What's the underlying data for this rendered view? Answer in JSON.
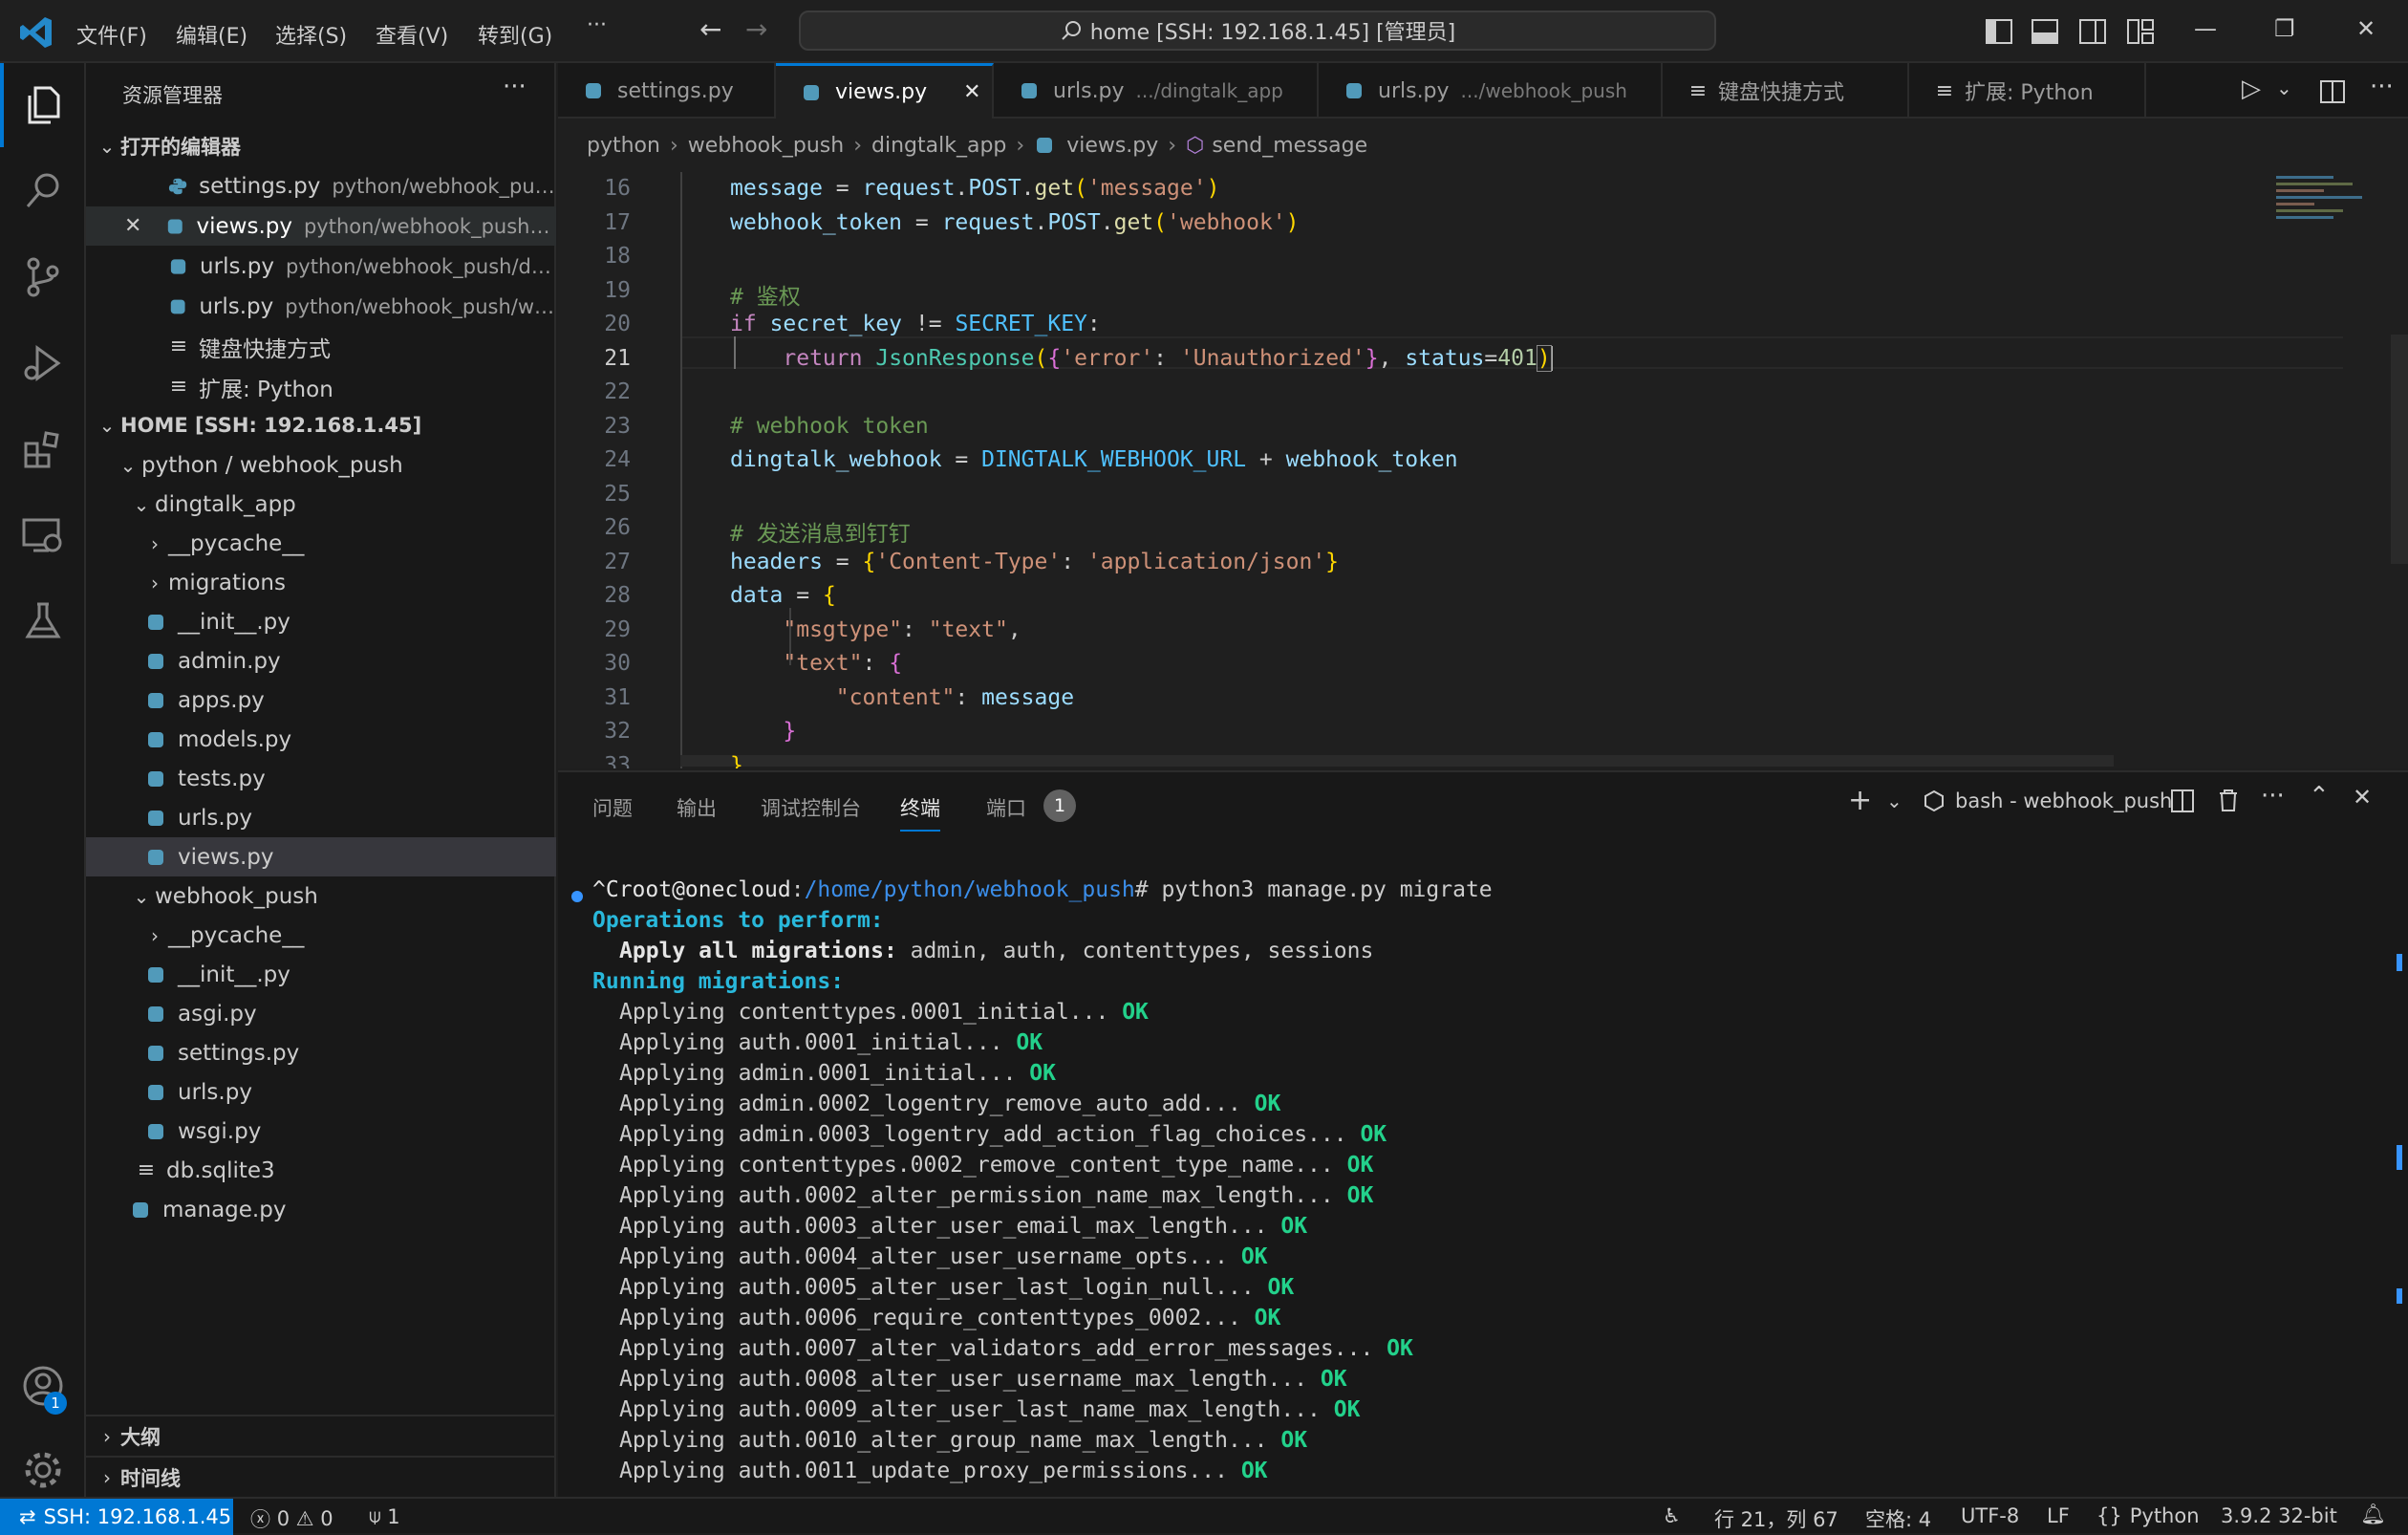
{
  "titlebar": {
    "menus": [
      "文件(F)",
      "编辑(E)",
      "选择(S)",
      "查看(V)",
      "转到(G)",
      "···"
    ],
    "search_text": "home [SSH: 192.168.1.45] [管理员]"
  },
  "sidebar": {
    "title": "资源管理器",
    "open_editors_header": "打开的编辑器",
    "open_editors": [
      {
        "name": "settings.py",
        "desc": "python/webhook_push..."
      },
      {
        "name": "views.py",
        "desc": "python/webhook_push/di..."
      },
      {
        "name": "urls.py",
        "desc": "python/webhook_push/din..."
      },
      {
        "name": "urls.py",
        "desc": "python/webhook_push/web..."
      },
      {
        "name": "键盘快捷方式",
        "desc": ""
      },
      {
        "name": "扩展: Python",
        "desc": ""
      }
    ],
    "workspace_header": "HOME [SSH: 192.168.1.45]",
    "tree": [
      {
        "label": "python / webhook_push"
      },
      {
        "label": "dingtalk_app"
      },
      {
        "label": "__pycache__"
      },
      {
        "label": "migrations"
      },
      {
        "label": "__init__.py"
      },
      {
        "label": "admin.py"
      },
      {
        "label": "apps.py"
      },
      {
        "label": "models.py"
      },
      {
        "label": "tests.py"
      },
      {
        "label": "urls.py"
      },
      {
        "label": "views.py"
      },
      {
        "label": "webhook_push"
      },
      {
        "label": "__pycache__"
      },
      {
        "label": "__init__.py"
      },
      {
        "label": "asgi.py"
      },
      {
        "label": "settings.py"
      },
      {
        "label": "urls.py"
      },
      {
        "label": "wsgi.py"
      },
      {
        "label": "db.sqlite3"
      },
      {
        "label": "manage.py"
      }
    ],
    "outline_header": "大纲",
    "timeline_header": "时间线",
    "accounts_badge": "1"
  },
  "tabs": [
    {
      "name": "settings.py",
      "desc": ""
    },
    {
      "name": "views.py",
      "desc": ""
    },
    {
      "name": "urls.py",
      "desc": ".../dingtalk_app"
    },
    {
      "name": "urls.py",
      "desc": ".../webhook_push"
    },
    {
      "name": "键盘快捷方式",
      "desc": ""
    },
    {
      "name": "扩展: Python",
      "desc": ""
    }
  ],
  "breadcrumb": [
    "python",
    "webhook_push",
    "dingtalk_app",
    "views.py",
    "send_message"
  ],
  "editor": {
    "line_numbers": [
      "16",
      "17",
      "18",
      "19",
      "20",
      "21",
      "22",
      "23",
      "24",
      "25",
      "26",
      "27",
      "28",
      "29",
      "30",
      "31",
      "32",
      "33"
    ],
    "current_line": "21"
  },
  "panel": {
    "tabs": [
      "问题",
      "输出",
      "调试控制台",
      "终端",
      "端口"
    ],
    "ports_badge": "1",
    "terminal_name": "bash - webhook_push",
    "prompt_user": "^Croot@onecloud",
    "prompt_path": "/home/python/webhook_push",
    "command": "# python3 manage.py migrate",
    "ops_header": "Operations to perform:",
    "apply_all_label": "Apply all migrations:",
    "apply_all_value": " admin, auth, contenttypes, sessions",
    "running_header": "Running migrations:",
    "migrations": [
      "contenttypes.0001_initial...",
      "auth.0001_initial...",
      "admin.0001_initial...",
      "admin.0002_logentry_remove_auto_add...",
      "admin.0003_logentry_add_action_flag_choices...",
      "contenttypes.0002_remove_content_type_name...",
      "auth.0002_alter_permission_name_max_length...",
      "auth.0003_alter_user_email_max_length...",
      "auth.0004_alter_user_username_opts...",
      "auth.0005_alter_user_last_login_null...",
      "auth.0006_require_contenttypes_0002...",
      "auth.0007_alter_validators_add_error_messages...",
      "auth.0008_alter_user_username_max_length...",
      "auth.0009_alter_user_last_name_max_length...",
      "auth.0010_alter_group_name_max_length...",
      "auth.0011_update_proxy_permissions..."
    ],
    "applying_word": "Applying ",
    "ok_word": " OK"
  },
  "statusbar": {
    "remote": "SSH: 192.168.1.45",
    "errors": "0",
    "warnings": "0",
    "ports": "1",
    "position": "行 21，列 67",
    "spaces": "空格: 4",
    "encoding": "UTF-8",
    "eol": "LF",
    "language": "Python",
    "interpreter": "3.9.2 32-bit"
  },
  "colors": {
    "accent": "#0078d4",
    "python_icon": "#519aba",
    "ok_green": "#23d18b",
    "header_cyan": "#29b8db"
  }
}
